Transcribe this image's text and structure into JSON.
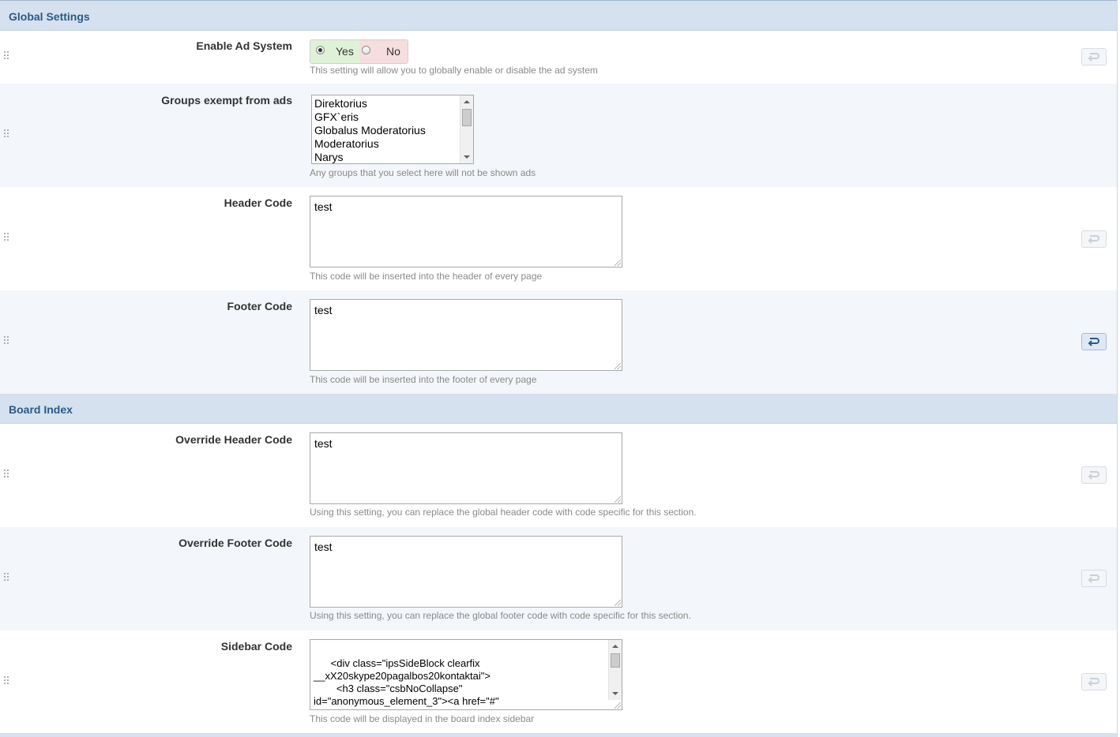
{
  "sections": [
    {
      "title": "Global Settings"
    },
    {
      "title": "Board Index"
    }
  ],
  "settings": {
    "enable_ad": {
      "label": "Enable Ad System",
      "yes_label": "Yes",
      "no_label": "No",
      "selected": "Yes",
      "description": "This setting will allow you to globally enable or disable the ad system"
    },
    "groups_exempt": {
      "label": "Groups exempt from ads",
      "options": [
        "Direktorius",
        "GFX`eris",
        "Globalus Moderatorius",
        "Moderatorius",
        "Narys"
      ],
      "description": "Any groups that you select here will not be shown ads"
    },
    "header_code": {
      "label": "Header Code",
      "value": "test",
      "description": "This code will be inserted into the header of every page"
    },
    "footer_code": {
      "label": "Footer Code",
      "value": "test",
      "description": "This code will be inserted into the footer of every page"
    },
    "override_header": {
      "label": "Override Header Code",
      "value": "test",
      "description": "Using this setting, you can replace the global header code with code specific for this section."
    },
    "override_footer": {
      "label": "Override Footer Code",
      "value": "test",
      "description": "Using this setting, you can replace the global footer code with code specific for this section."
    },
    "sidebar_code": {
      "label": "Sidebar Code",
      "value": "<div class=\"ipsSideBlock clearfix\n__xX20skype20pagalbos20kontaktai\">\n        <h3 class=\"csbNoCollapse\"\nid=\"anonymous_element_3\"><a href=\"#\"\nclass=\"ipsSidebar_trigger ipsType_smaller right desc",
      "description": "This code will be displayed in the board index sidebar"
    }
  },
  "icons": {
    "revert": "revert-arrow-icon",
    "drag": "drag-handle-icon"
  },
  "colors": {
    "section_header_bg": "#d5e1ee",
    "section_header_text": "#2b5a87",
    "alt_row_bg": "#f3f6fa",
    "yes_bg": "#dff2d8",
    "no_bg": "#f6dede"
  }
}
